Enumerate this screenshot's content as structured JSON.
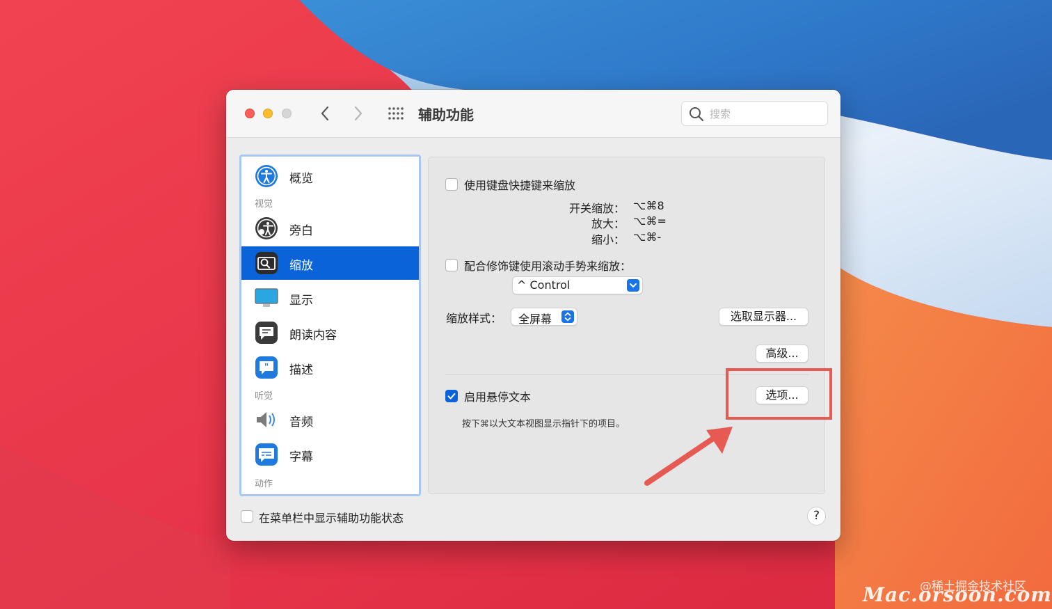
{
  "window": {
    "title": "辅助功能",
    "search_placeholder": "搜索"
  },
  "sidebar": {
    "items": [
      {
        "label": "概览",
        "icon": "accessibility-overview-icon"
      },
      {
        "label": "旁白",
        "icon": "voiceover-icon"
      },
      {
        "label": "缩放",
        "icon": "zoom-icon",
        "selected": true
      },
      {
        "label": "显示",
        "icon": "display-icon"
      },
      {
        "label": "朗读内容",
        "icon": "spoken-content-icon"
      },
      {
        "label": "描述",
        "icon": "descriptions-icon"
      },
      {
        "label": "音频",
        "icon": "audio-icon"
      },
      {
        "label": "字幕",
        "icon": "captions-icon"
      }
    ],
    "categories": {
      "vision": "视觉",
      "hearing": "听觉",
      "motor": "动作"
    }
  },
  "zoom_panel": {
    "keyboard_shortcuts_label": "使用键盘快捷键来缩放",
    "keyboard_shortcuts_checked": false,
    "shortcuts": [
      {
        "label": "开关缩放：",
        "keys": "⌥⌘8"
      },
      {
        "label": "放大：",
        "keys": "⌥⌘="
      },
      {
        "label": "缩小：",
        "keys": "⌥⌘-"
      }
    ],
    "scroll_gesture_label": "配合修饰键使用滚动手势来缩放：",
    "scroll_gesture_checked": false,
    "modifier_value": "^ Control",
    "zoom_style_label": "缩放样式：",
    "zoom_style_value": "全屏幕",
    "choose_display_button": "选取显示器...",
    "advanced_button": "高级...",
    "hover_text_label": "启用悬停文本",
    "hover_text_checked": true,
    "options_button": "选项...",
    "hover_text_hint": "按下⌘以大文本视图显示指针下的项目。"
  },
  "footer": {
    "show_in_menubar_label": "在菜单栏中显示辅助功能状态",
    "show_in_menubar_checked": false,
    "help_label": "?"
  },
  "watermark": {
    "small": "@稀土掘金技术社区",
    "big": "Mac.orsoon.com"
  },
  "colors": {
    "accent": "#0a63d8",
    "annotation": "#e65a53"
  }
}
